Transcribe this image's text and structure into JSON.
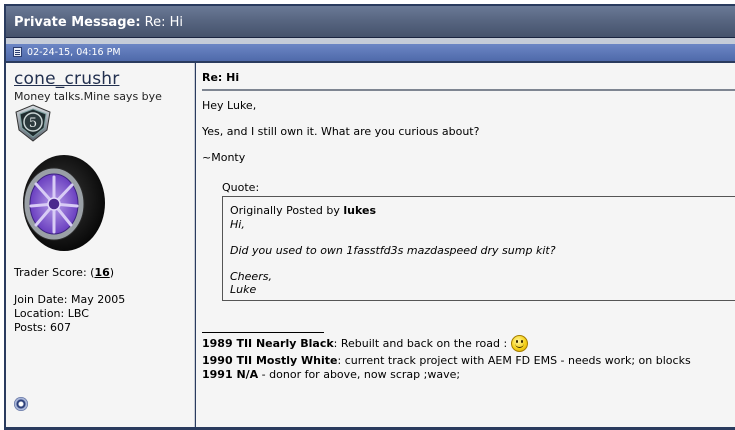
{
  "header": {
    "label": "Private Message:",
    "subject": "Re: Hi"
  },
  "post": {
    "date": "02-24-15, 04:16 PM"
  },
  "user": {
    "name": "cone_crushr",
    "title": "Money talks.Mine says bye",
    "badge_number": "5",
    "trader_label": "Trader Score: (",
    "trader_score": "16",
    "trader_close": ")",
    "join_date": "Join Date: May 2005",
    "location": "Location: LBC",
    "posts": "Posts: 607"
  },
  "message": {
    "title": "Re: Hi",
    "lines": [
      "Hey Luke,",
      "Yes, and I still own it. What are you curious about?",
      "~Monty"
    ],
    "quote_label": "Quote:",
    "quote": {
      "prefix": "Originally Posted by",
      "author": "lukes",
      "lines": [
        "Hi,",
        "Did you used to own 1fasstfd3s mazdaspeed dry sump kit?",
        "Cheers,",
        "Luke"
      ]
    }
  },
  "signature": [
    {
      "bold": "1989 TII Nearly Black",
      "text": ": Rebuilt and back on the road :"
    },
    {
      "bold": "1990 TII Mostly White",
      "text": ": current track project with AEM FD EMS - needs work; on blocks"
    },
    {
      "bold": "1991 N/A",
      "text": " - donor for above, now scrap ;wave;"
    }
  ],
  "icons": {
    "post": "post-icon",
    "smiley": "smiley-icon",
    "online": "online-status-icon",
    "badge": "rank-badge-icon",
    "avatar": "wheel-avatar"
  }
}
